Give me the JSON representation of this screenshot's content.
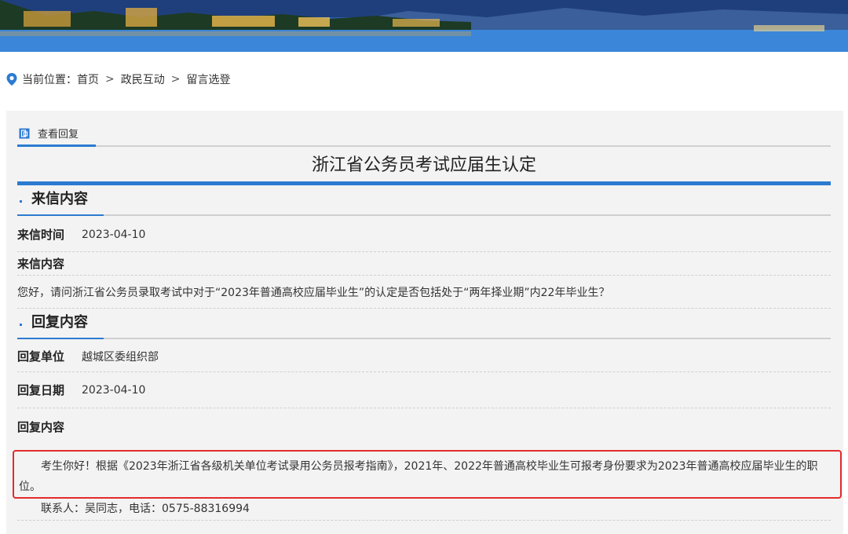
{
  "breadcrumb": {
    "prefix": "当前位置：",
    "items": [
      "首页",
      "政民互动",
      "留言选登"
    ],
    "separator": ">"
  },
  "tab": {
    "label": "查看回复",
    "icon": "document-icon"
  },
  "title": "浙江省公务员考试应届生认定",
  "letter_section": {
    "heading": "来信内容",
    "time_label": "来信时间",
    "time_value": "2023-04-10",
    "content_label": "来信内容",
    "content_text": "您好，请问浙江省公务员录取考试中对于“2023年普通高校应届毕业生”的认定是否包括处于“两年择业期”内22年毕业生？"
  },
  "reply_section": {
    "heading": "回复内容",
    "unit_label": "回复单位",
    "unit_value": "越城区委组织部",
    "date_label": "回复日期",
    "date_value": "2023-04-10",
    "content_label": "回复内容",
    "content_text": "考生你好！根据《2023年浙江省各级机关单位考试录用公务员报考指南》，2021年、2022年普通高校毕业生可报考身份要求为2023年普通高校应届毕业生的职位。",
    "contact": "联系人：吴同志，电话：0575-88316994"
  },
  "colors": {
    "accent": "#2c7bd1",
    "highlight_border": "#e22b2b"
  }
}
